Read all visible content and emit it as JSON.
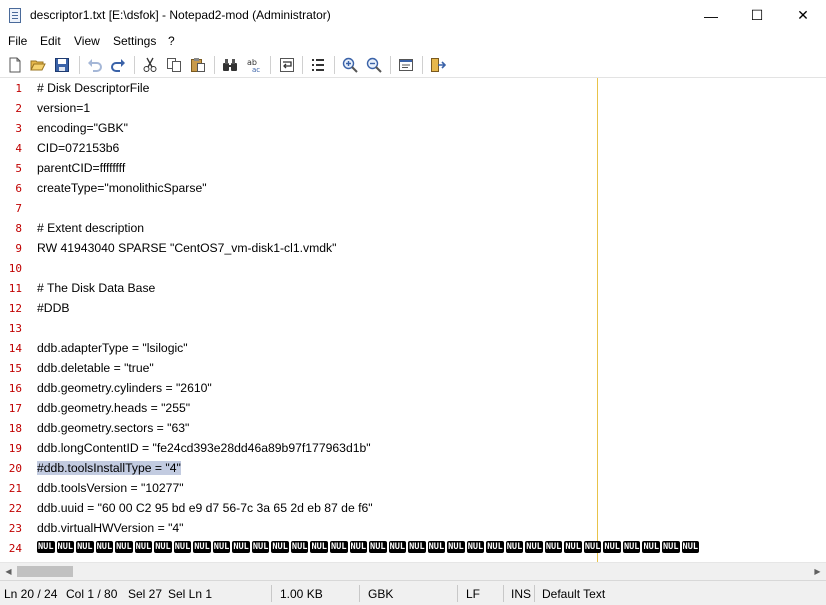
{
  "window": {
    "title": "descriptor1.txt [E:\\dsfok] - Notepad2-mod (Administrator)",
    "controls": {
      "minimize": "—",
      "maximize": "☐",
      "close": "✕"
    }
  },
  "menu": {
    "items": [
      {
        "label": "File"
      },
      {
        "label": "Edit"
      },
      {
        "label": "View"
      },
      {
        "label": "Settings"
      },
      {
        "label": "?"
      }
    ]
  },
  "toolbar": {
    "buttons": [
      "new-file-icon",
      "open-folder-icon",
      "save-icon",
      "undo-icon",
      "redo-icon",
      "cut-icon",
      "copy-icon",
      "paste-icon",
      "find-icon",
      "replace-icon",
      "word-wrap-icon",
      "line-numbers-icon",
      "zoom-in-icon",
      "zoom-out-icon",
      "scheme-icon",
      "exit-icon"
    ]
  },
  "editor": {
    "lines": [
      {
        "n": "1",
        "text": "# Disk DescriptorFile"
      },
      {
        "n": "2",
        "text": "version=1"
      },
      {
        "n": "3",
        "text": "encoding=\"GBK\""
      },
      {
        "n": "4",
        "text": "CID=072153b6"
      },
      {
        "n": "5",
        "text": "parentCID=ffffffff"
      },
      {
        "n": "6",
        "text": "createType=\"monolithicSparse\""
      },
      {
        "n": "7",
        "text": ""
      },
      {
        "n": "8",
        "text": "# Extent description"
      },
      {
        "n": "9",
        "text": "RW 41943040 SPARSE \"CentOS7_vm-disk1-cl1.vmdk\""
      },
      {
        "n": "10",
        "text": ""
      },
      {
        "n": "11",
        "text": "# The Disk Data Base"
      },
      {
        "n": "12",
        "text": "#DDB"
      },
      {
        "n": "13",
        "text": ""
      },
      {
        "n": "14",
        "text": "ddb.adapterType = \"lsilogic\""
      },
      {
        "n": "15",
        "text": "ddb.deletable = \"true\""
      },
      {
        "n": "16",
        "text": "ddb.geometry.cylinders = \"2610\""
      },
      {
        "n": "17",
        "text": "ddb.geometry.heads = \"255\""
      },
      {
        "n": "18",
        "text": "ddb.geometry.sectors = \"63\""
      },
      {
        "n": "19",
        "text": "ddb.longContentID = \"fe24cd393e28dd46a89b97f177963d1b\""
      },
      {
        "n": "20",
        "text": "#ddb.toolsInstallType = \"4\""
      },
      {
        "n": "21",
        "text": "ddb.toolsVersion = \"10277\""
      },
      {
        "n": "22",
        "text": "ddb.uuid = \"60 00 C2 95 bd e9 d7 56-7c 3a 65 2d eb 87 de f6\""
      },
      {
        "n": "23",
        "text": "ddb.virtualHWVersion = \"4\""
      },
      {
        "n": "24",
        "text": ""
      }
    ],
    "selected_line": "20",
    "nul_label": "NUL",
    "colors": {
      "line_number": "#c00000",
      "selection": "#c2cbe0",
      "long_line_marker": "#e8c34a"
    }
  },
  "status": {
    "ln": "Ln 20 / 24",
    "col": "Col 1 / 80",
    "sel": "Sel 27",
    "sel_ln": "Sel Ln 1",
    "size": "1.00 KB",
    "encoding": "GBK",
    "eol": "LF",
    "ins": "INS",
    "scheme": "Default Text"
  }
}
